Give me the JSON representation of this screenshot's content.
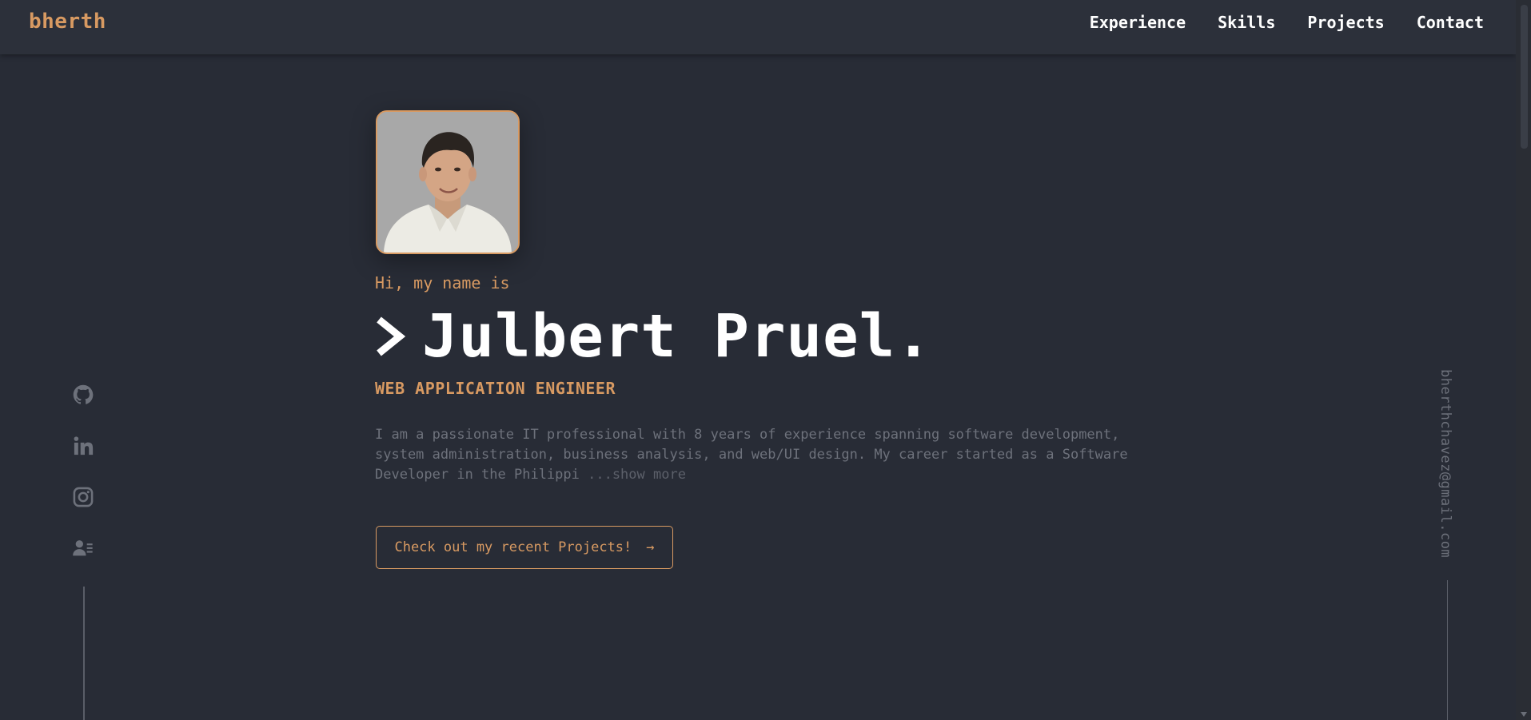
{
  "header": {
    "logo": "bherth",
    "nav": [
      "Experience",
      "Skills",
      "Projects",
      "Contact"
    ]
  },
  "hero": {
    "greeting": "Hi, my name is",
    "name": "Julbert Pruel.",
    "role": "WEB APPLICATION ENGINEER",
    "bio": "I am a passionate IT professional with 8 years of experience spanning software development, system administration, business analysis, and web/UI design. My career started as a Software Developer in the Philippi",
    "show_more": " ...show more",
    "cta": "Check out my recent Projects!",
    "cta_arrow": "→"
  },
  "social_icons": [
    "github-icon",
    "linkedin-icon",
    "instagram-icon",
    "resume-icon"
  ],
  "email": "bherthchavez@gmail.com",
  "colors": {
    "accent": "#d89a62",
    "background": "#282c36",
    "header": "#2c303a",
    "muted": "#6d717b"
  }
}
